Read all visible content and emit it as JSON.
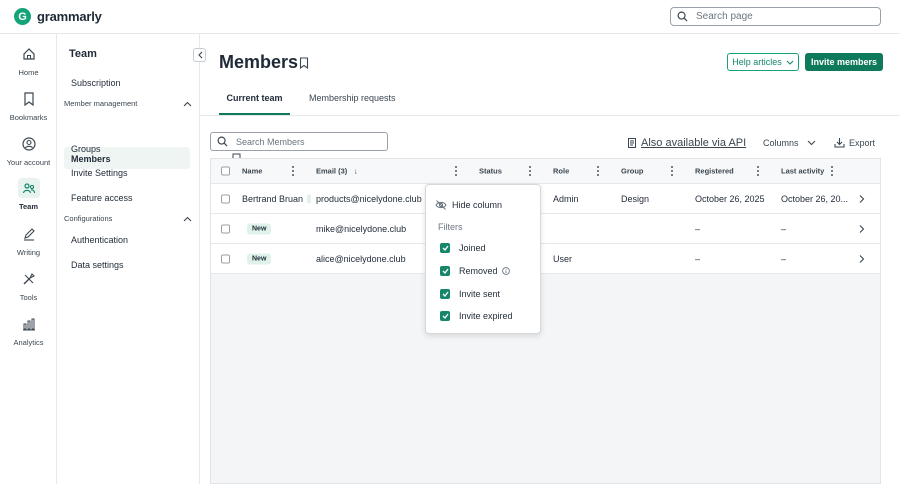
{
  "app": {
    "logo_text": "grammarly",
    "logo_mark": "G"
  },
  "topbar": {
    "search_placeholder": "Search page"
  },
  "rail": {
    "items": [
      {
        "label": "Home",
        "icon": "home-icon"
      },
      {
        "label": "Bookmarks",
        "icon": "bookmark-icon"
      },
      {
        "label": "Your account",
        "icon": "user-circle-icon"
      },
      {
        "label": "Team",
        "icon": "team-icon",
        "active": true
      },
      {
        "label": "Writing",
        "icon": "pen-icon"
      },
      {
        "label": "Tools",
        "icon": "tools-icon"
      },
      {
        "label": "Analytics",
        "icon": "analytics-icon"
      }
    ]
  },
  "subnav": {
    "title": "Team",
    "subscription": "Subscription",
    "member_management": "Member management",
    "members": "Members",
    "groups": "Groups",
    "invite_settings": "Invite Settings",
    "feature_access": "Feature access",
    "configurations": "Configurations",
    "authentication": "Authentication",
    "data_settings": "Data settings"
  },
  "main": {
    "title": "Members",
    "help_articles": "Help articles",
    "invite_members": "Invite members",
    "tabs": [
      {
        "label": "Current team",
        "active": true
      },
      {
        "label": "Membership requests",
        "active": false
      }
    ],
    "search_placeholder": "Search Members",
    "api_link": "Also available via API",
    "columns_label": "Columns",
    "export_label": "Export"
  },
  "table": {
    "columns": {
      "name": "Name",
      "email": "Email (3)",
      "email_sort": "↓",
      "status": "Status",
      "role": "Role",
      "group": "Group",
      "registered": "Registered",
      "last_activity": "Last activity"
    },
    "rows": [
      {
        "name": "Bertrand Bruan",
        "badge": "",
        "email": "products@nicelydone.club",
        "role": "Admin",
        "group": "Design",
        "registered": "October 26, 2025",
        "last_activity": "October 26, 20..."
      },
      {
        "name": "",
        "badge": "New",
        "email": "mike@nicelydone.club",
        "role": "",
        "group": "",
        "registered": "–",
        "last_activity": "–"
      },
      {
        "name": "",
        "badge": "New",
        "email": "alice@nicelydone.club",
        "role": "User",
        "group": "",
        "registered": "–",
        "last_activity": "–"
      }
    ]
  },
  "popover": {
    "hide_column": "Hide column",
    "filters_label": "Filters",
    "filters": [
      {
        "label": "Joined",
        "checked": true
      },
      {
        "label": "Removed",
        "checked": true,
        "info": true
      },
      {
        "label": "Invite sent",
        "checked": true
      },
      {
        "label": "Invite expired",
        "checked": true
      }
    ]
  },
  "colors": {
    "brand": "#15a37a",
    "primary_button": "#0f7a5b",
    "active_bg": "#eef5f2"
  }
}
